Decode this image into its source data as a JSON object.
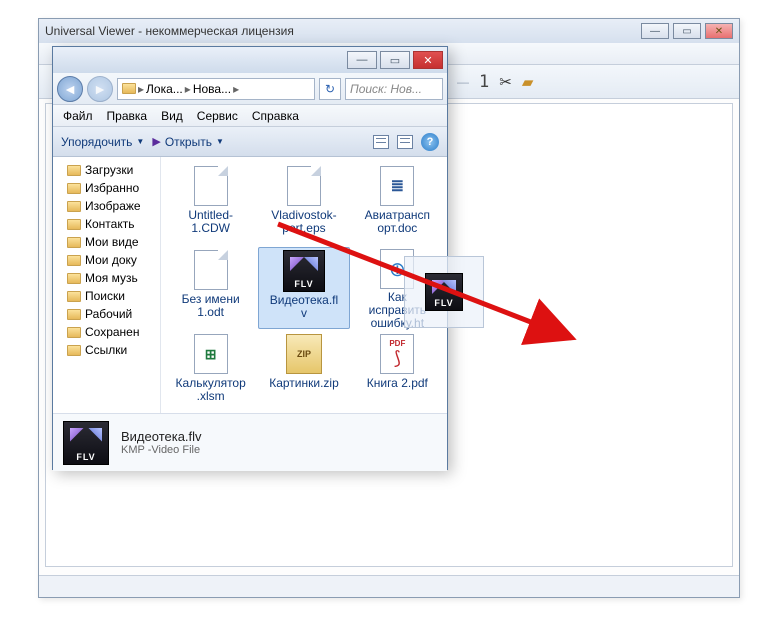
{
  "app": {
    "title": "Universal Viewer - некоммерческая лицензия",
    "toolbar_num": "1"
  },
  "explorer": {
    "breadcrumb": {
      "p1": "Лока...",
      "p2": "Нова..."
    },
    "search_placeholder": "Поиск: Нов...",
    "menu": {
      "file": "Файл",
      "edit": "Правка",
      "view": "Вид",
      "tools": "Сервис",
      "help": "Справка"
    },
    "toolbar": {
      "organize": "Упорядочить",
      "open": "Открыть"
    },
    "tree": [
      "Загрузки",
      "Избранно",
      "Изображе",
      "Контакть",
      "Мои виде",
      "Мои доку",
      "Моя музь",
      "Поиски",
      "Рабочий",
      "Сохранен",
      "Ссылки"
    ],
    "files": [
      {
        "label": "Untitled-1.CDW",
        "type": "page"
      },
      {
        "label": "Vladivostok-port.eps",
        "type": "page"
      },
      {
        "label": "Авиатранспорт.doc",
        "type": "doc"
      },
      {
        "label": "Без имени 1.odt",
        "type": "page"
      },
      {
        "label": "Видеотека.flv",
        "type": "flv",
        "selected": true
      },
      {
        "label": "Как исправить ошибку.ht",
        "type": "globe"
      },
      {
        "label": "Калькулятор.xlsm",
        "type": "xls"
      },
      {
        "label": "Картинки.zip",
        "type": "zip"
      },
      {
        "label": "Книга 2.pdf",
        "type": "pdf"
      }
    ],
    "details": {
      "name": "Видеотека.flv",
      "type": "KMP -Video File"
    },
    "flv_badge": "FLV",
    "zip_badge": "ZIP",
    "pdf_badge": "PDF"
  }
}
